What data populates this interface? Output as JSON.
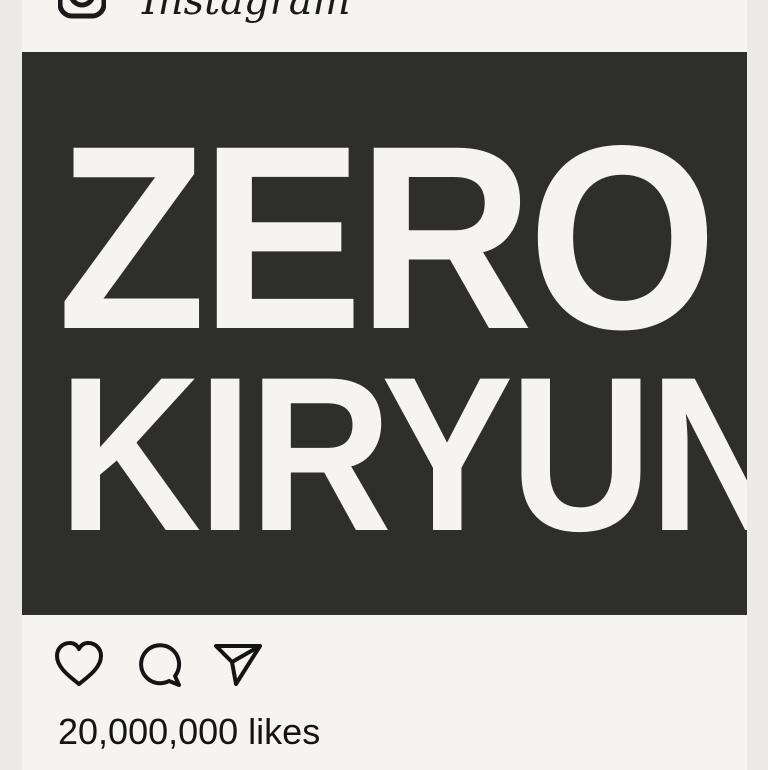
{
  "header": {
    "brand_name": "Instagram",
    "logo_icon": "instagram-camera-icon",
    "more_icon": "more-options-icon"
  },
  "post": {
    "image_text_line1": "ZERO",
    "image_text_line2": "KIRYUN",
    "image_background": "#2e2e2d",
    "image_text_color": "#f5f4f0"
  },
  "actions": {
    "like_icon": "heart-icon",
    "comment_icon": "comment-icon",
    "share_icon": "send-icon"
  },
  "likes_text": "20,000,000 likes"
}
